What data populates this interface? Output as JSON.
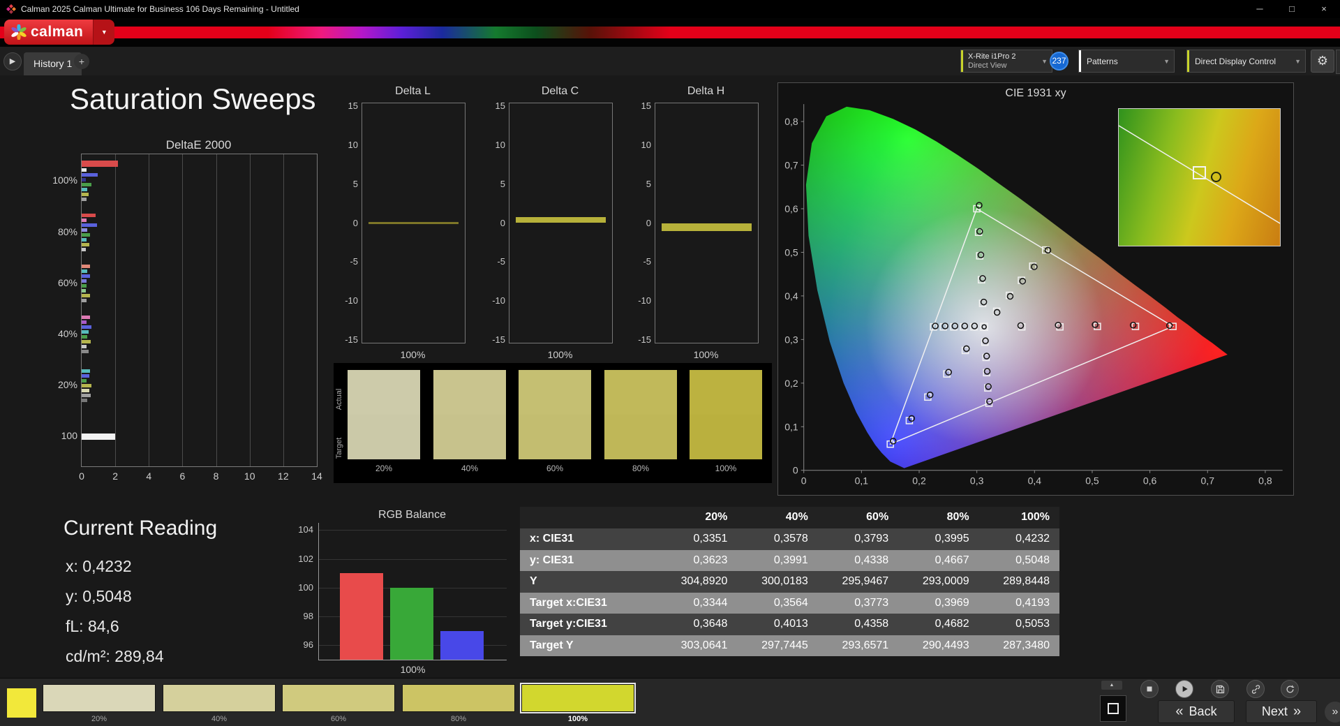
{
  "window": {
    "title": "Calman 2025 Calman Ultimate for Business 106 Days Remaining - Untitled",
    "minimize": "─",
    "restore": "□",
    "close": "×"
  },
  "logo": {
    "wordmark": "calman",
    "dropdown": "▼"
  },
  "tabbar": {
    "nav": "▶",
    "history_tab": "History 1",
    "add": "+",
    "meter_line1": "X-Rite i1Pro 2",
    "meter_line2": "Direct View",
    "badge": "237",
    "patterns": "Patterns",
    "display_control": "Direct Display Control",
    "gear": "⚙",
    "arrow": "▼"
  },
  "page_title": "Saturation Sweeps",
  "deltae": {
    "title": "DeltaE 2000",
    "xmax": 14,
    "xticks": [
      "0",
      "2",
      "4",
      "6",
      "8",
      "10",
      "12",
      "14"
    ],
    "groups": [
      {
        "label": "100%",
        "bars": [
          {
            "c": "#d94b4b",
            "v": 2.15,
            "h": 9
          },
          {
            "c": "#e8e8e8",
            "v": 0.3
          },
          {
            "c": "#5a62dd",
            "v": 0.95
          },
          {
            "c": "#34348c",
            "v": 0.25
          },
          {
            "c": "#4a9e4a",
            "v": 0.6
          },
          {
            "c": "#57bcbc",
            "v": 0.35
          },
          {
            "c": "#b6b64e",
            "v": 0.4
          },
          {
            "c": "#a0a0a0",
            "v": 0.3
          }
        ]
      },
      {
        "label": "80%",
        "bars": [
          {
            "c": "#d94b4b",
            "v": 0.85
          },
          {
            "c": "#de7ab4",
            "v": 0.3
          },
          {
            "c": "#5a62dd",
            "v": 0.9
          },
          {
            "c": "#8c8ce0",
            "v": 0.35
          },
          {
            "c": "#4a9e4a",
            "v": 0.5
          },
          {
            "c": "#57bcbc",
            "v": 0.3
          },
          {
            "c": "#b6b64e",
            "v": 0.45
          },
          {
            "c": "#c8c8c8",
            "v": 0.25
          }
        ]
      },
      {
        "label": "60%",
        "bars": [
          {
            "c": "#e08878",
            "v": 0.5
          },
          {
            "c": "#57bcbc",
            "v": 0.35
          },
          {
            "c": "#5a62dd",
            "v": 0.5
          },
          {
            "c": "#7a7ad8",
            "v": 0.3
          },
          {
            "c": "#4a9e4a",
            "v": 0.3
          },
          {
            "c": "#8cc88c",
            "v": 0.25
          },
          {
            "c": "#b6b64e",
            "v": 0.5
          },
          {
            "c": "#a0a0a0",
            "v": 0.3
          }
        ]
      },
      {
        "label": "40%",
        "bars": [
          {
            "c": "#de7ab4",
            "v": 0.5
          },
          {
            "c": "#a85ac8",
            "v": 0.3
          },
          {
            "c": "#5a62dd",
            "v": 0.6
          },
          {
            "c": "#57bcbc",
            "v": 0.4
          },
          {
            "c": "#4a9e4a",
            "v": 0.35
          },
          {
            "c": "#b6b64e",
            "v": 0.55
          },
          {
            "c": "#c8c8c8",
            "v": 0.3
          },
          {
            "c": "#8a8a8a",
            "v": 0.4
          }
        ]
      },
      {
        "label": "20%",
        "bars": [
          {
            "c": "#57bcbc",
            "v": 0.5
          },
          {
            "c": "#5a62dd",
            "v": 0.45
          },
          {
            "c": "#4a9e4a",
            "v": 0.3
          },
          {
            "c": "#b6b64e",
            "v": 0.6
          },
          {
            "c": "#d8d8b0",
            "v": 0.45
          },
          {
            "c": "#a0a0a0",
            "v": 0.55
          },
          {
            "c": "#787878",
            "v": 0.35
          }
        ]
      },
      {
        "label": "100",
        "bars": [
          {
            "c": "#f2f2f2",
            "v": 2.0,
            "h": 9
          }
        ]
      }
    ]
  },
  "delta_yticks": [
    "15",
    "10",
    "5",
    "0",
    "-5",
    "-10",
    "-15"
  ],
  "delta_small": [
    {
      "title": "Delta L",
      "xlabel": "100%",
      "value": 0.15,
      "color": "#7d7628"
    },
    {
      "title": "Delta C",
      "xlabel": "100%",
      "value": 0.8,
      "color": "#b7b13a"
    },
    {
      "title": "Delta H",
      "xlabel": "100%",
      "value": -1.0,
      "color": "#b7b13a"
    }
  ],
  "swatch_panel": {
    "row1": "Actual",
    "row2": "Target",
    "items": [
      {
        "label": "20%",
        "actual": "#cdcbaa",
        "target": "#cbc9a8"
      },
      {
        "label": "40%",
        "actual": "#c9c48e",
        "target": "#c7c28c"
      },
      {
        "label": "60%",
        "actual": "#c5bf72",
        "target": "#c3bd70"
      },
      {
        "label": "80%",
        "actual": "#c1b95a",
        "target": "#bfb758"
      },
      {
        "label": "100%",
        "actual": "#bcb240",
        "target": "#bab03e"
      }
    ]
  },
  "cie": {
    "title": "CIE 1931 xy",
    "xticks": [
      "0",
      "0,1",
      "0,2",
      "0,3",
      "0,4",
      "0,5",
      "0,6",
      "0,7",
      "0,8"
    ],
    "yticks": [
      "0",
      "0,1",
      "0,2",
      "0,3",
      "0,4",
      "0,5",
      "0,6",
      "0,7",
      "0,8"
    ],
    "triangle": [
      [
        0.64,
        0.33
      ],
      [
        0.3,
        0.6
      ],
      [
        0.15,
        0.06
      ]
    ],
    "white_point": [
      0.3127,
      0.329
    ],
    "sweeps": {
      "red": {
        "targets": [
          [
            0.378,
            0.329
          ],
          [
            0.444,
            0.329
          ],
          [
            0.509,
            0.33
          ],
          [
            0.575,
            0.33
          ],
          [
            0.64,
            0.33
          ]
        ],
        "measured": [
          [
            0.376,
            0.332
          ],
          [
            0.441,
            0.333
          ],
          [
            0.505,
            0.334
          ],
          [
            0.571,
            0.333
          ],
          [
            0.634,
            0.332
          ]
        ]
      },
      "green": {
        "targets": [
          [
            0.31,
            0.383
          ],
          [
            0.308,
            0.437
          ],
          [
            0.305,
            0.492
          ],
          [
            0.303,
            0.546
          ],
          [
            0.3,
            0.6
          ]
        ],
        "measured": [
          [
            0.312,
            0.386
          ],
          [
            0.31,
            0.44
          ],
          [
            0.307,
            0.494
          ],
          [
            0.305,
            0.548
          ],
          [
            0.304,
            0.608
          ]
        ]
      },
      "blue": {
        "targets": [
          [
            0.28,
            0.275
          ],
          [
            0.248,
            0.221
          ],
          [
            0.215,
            0.168
          ],
          [
            0.183,
            0.114
          ],
          [
            0.15,
            0.06
          ]
        ],
        "measured": [
          [
            0.282,
            0.279
          ],
          [
            0.251,
            0.225
          ],
          [
            0.219,
            0.173
          ],
          [
            0.187,
            0.119
          ],
          [
            0.155,
            0.067
          ]
        ]
      },
      "cyan": {
        "targets": [
          [
            0.295,
            0.329
          ],
          [
            0.277,
            0.329
          ],
          [
            0.26,
            0.329
          ],
          [
            0.242,
            0.329
          ],
          [
            0.225,
            0.329
          ]
        ],
        "measured": [
          [
            0.296,
            0.331
          ],
          [
            0.279,
            0.331
          ],
          [
            0.262,
            0.331
          ],
          [
            0.245,
            0.331
          ],
          [
            0.228,
            0.331
          ]
        ]
      },
      "magenta": {
        "targets": [
          [
            0.314,
            0.294
          ],
          [
            0.316,
            0.259
          ],
          [
            0.317,
            0.224
          ],
          [
            0.319,
            0.189
          ],
          [
            0.321,
            0.154
          ]
        ],
        "measured": [
          [
            0.315,
            0.297
          ],
          [
            0.317,
            0.262
          ],
          [
            0.318,
            0.227
          ],
          [
            0.32,
            0.192
          ],
          [
            0.322,
            0.158
          ]
        ]
      },
      "yellow": {
        "targets": [
          [
            0.3344,
            0.3648
          ],
          [
            0.3564,
            0.4013
          ],
          [
            0.3773,
            0.4358
          ],
          [
            0.3969,
            0.4682
          ],
          [
            0.4193,
            0.5053
          ]
        ],
        "measured": [
          [
            0.3351,
            0.3623
          ],
          [
            0.3578,
            0.3991
          ],
          [
            0.3793,
            0.4338
          ],
          [
            0.3995,
            0.4667
          ],
          [
            0.4232,
            0.5048
          ]
        ]
      }
    }
  },
  "current": {
    "title": "Current Reading",
    "lines": [
      "x: 0,4232",
      "y: 0,5048",
      "fL: 84,6",
      "cd/m²: 289,84"
    ]
  },
  "rgb": {
    "title": "RGB Balance",
    "xlabel": "100%",
    "ymin": 95,
    "yrange": 9.5,
    "yticks": [
      104,
      102,
      100,
      98,
      96
    ],
    "bars": [
      {
        "color": "#e84b4b",
        "value": 101
      },
      {
        "color": "#38a838",
        "value": 100
      },
      {
        "color": "#4848e8",
        "value": 97
      }
    ]
  },
  "table": {
    "headers": [
      "20%",
      "40%",
      "60%",
      "80%",
      "100%"
    ],
    "rows": [
      {
        "label": "x: CIE31",
        "values": [
          "0,3351",
          "0,3578",
          "0,3793",
          "0,3995",
          "0,4232"
        ]
      },
      {
        "label": "y: CIE31",
        "values": [
          "0,3623",
          "0,3991",
          "0,4338",
          "0,4667",
          "0,5048"
        ]
      },
      {
        "label": "Y",
        "values": [
          "304,8920",
          "300,0183",
          "295,9467",
          "293,0009",
          "289,8448"
        ]
      },
      {
        "label": "Target x:CIE31",
        "values": [
          "0,3344",
          "0,3564",
          "0,3773",
          "0,3969",
          "0,4193"
        ]
      },
      {
        "label": "Target y:CIE31",
        "values": [
          "0,3648",
          "0,4013",
          "0,4358",
          "0,4682",
          "0,5053"
        ]
      },
      {
        "label": "Target Y",
        "values": [
          "303,0641",
          "297,7445",
          "293,6571",
          "290,4493",
          "287,3480"
        ]
      }
    ]
  },
  "bottombar": {
    "pattern_color": "#f2e83a",
    "swatches": [
      {
        "label": "20%",
        "color": "#dad7b8"
      },
      {
        "label": "40%",
        "color": "#d5d09c"
      },
      {
        "label": "60%",
        "color": "#d0ca7e"
      },
      {
        "label": "80%",
        "color": "#ccc464"
      },
      {
        "label": "100%",
        "color": "#d2d72e"
      }
    ],
    "selected": 4,
    "icons": [
      "scroll-up-icon",
      "stop-icon",
      "play-icon",
      "save-icon",
      "link-icon",
      "refresh-icon"
    ],
    "back": "Back",
    "next": "Next",
    "edge": "»",
    "up": "▲"
  }
}
